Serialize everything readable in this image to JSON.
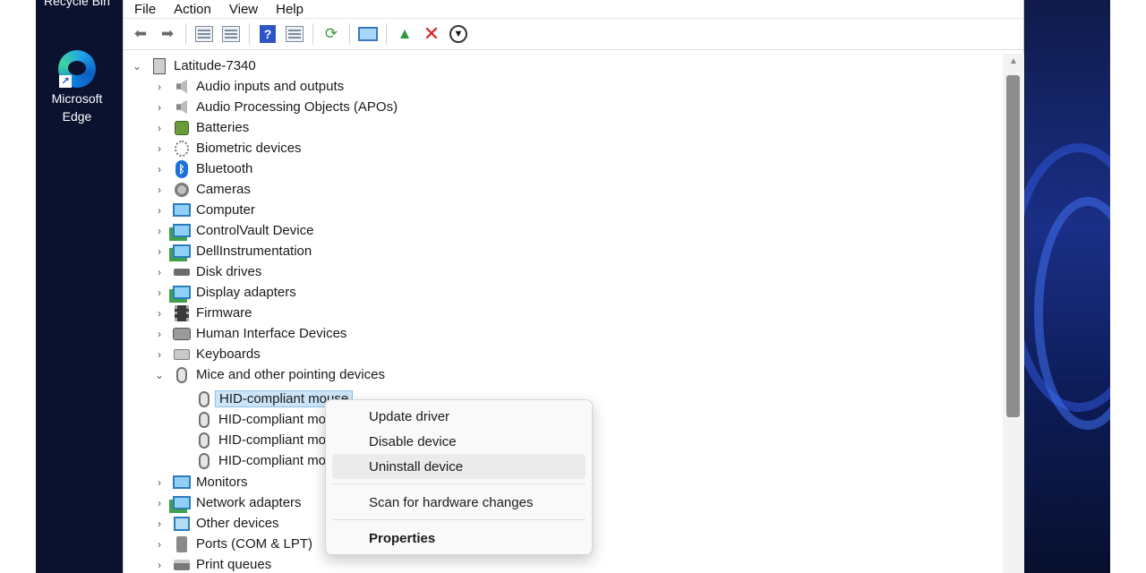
{
  "desktop": {
    "recycle_bin_label": "Recycle Bin",
    "edge_label": "Microsoft Edge"
  },
  "menubar": [
    "File",
    "Action",
    "View",
    "Help"
  ],
  "toolbar": [
    "back-arrow-icon",
    "forward-arrow-icon",
    "show-hide-console-tree-icon",
    "properties-icon",
    "help-icon",
    "export-list-icon",
    "update-driver-icon",
    "scan-hardware-icon",
    "enable-device-icon",
    "uninstall-device-icon",
    "download-icon"
  ],
  "tree": {
    "root": "Latitude-7340",
    "items": [
      {
        "label": "Audio inputs and outputs",
        "icon": "speaker-icon"
      },
      {
        "label": "Audio Processing Objects (APOs)",
        "icon": "speaker-icon"
      },
      {
        "label": "Batteries",
        "icon": "battery-icon"
      },
      {
        "label": "Biometric devices",
        "icon": "fingerprint-icon"
      },
      {
        "label": "Bluetooth",
        "icon": "bluetooth-icon"
      },
      {
        "label": "Cameras",
        "icon": "camera-icon"
      },
      {
        "label": "Computer",
        "icon": "monitor-icon"
      },
      {
        "label": "ControlVault Device",
        "icon": "monitor-icon"
      },
      {
        "label": "DellInstrumentation",
        "icon": "monitor-icon"
      },
      {
        "label": "Disk drives",
        "icon": "disk-icon"
      },
      {
        "label": "Display adapters",
        "icon": "display-adapter-icon"
      },
      {
        "label": "Firmware",
        "icon": "chip-icon"
      },
      {
        "label": "Human Interface Devices",
        "icon": "hid-icon"
      },
      {
        "label": "Keyboards",
        "icon": "keyboard-icon"
      },
      {
        "label": "Mice and other pointing devices",
        "icon": "mouse-icon",
        "expanded": true,
        "children": [
          "HID-compliant mouse",
          "HID-compliant mo",
          "HID-compliant mo",
          "HID-compliant mo"
        ]
      },
      {
        "label": "Monitors",
        "icon": "monitor-icon"
      },
      {
        "label": "Network adapters",
        "icon": "network-icon"
      },
      {
        "label": "Other devices",
        "icon": "unknown-device-icon"
      },
      {
        "label": "Ports (COM & LPT)",
        "icon": "port-icon"
      },
      {
        "label": "Print queues",
        "icon": "printer-icon"
      }
    ]
  },
  "context_menu": {
    "update_driver": "Update driver",
    "disable_device": "Disable device",
    "uninstall_device": "Uninstall device",
    "scan_hardware": "Scan for hardware changes",
    "properties": "Properties"
  },
  "colors": {
    "selection": "#cce4f7",
    "uninstall_red": "#d81f1f",
    "menu_hover": "#ebebeb"
  }
}
